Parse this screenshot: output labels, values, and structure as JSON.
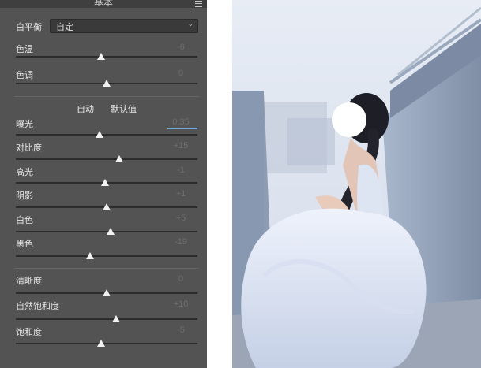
{
  "panel": {
    "title": "基本",
    "white_balance": {
      "label": "白平衡:",
      "value": "自定"
    },
    "auto_label": "自动",
    "default_label": "默认值",
    "sliders": [
      {
        "id": "temperature",
        "label": "色温",
        "value": "-6",
        "position": 0.47
      },
      {
        "id": "tint",
        "label": "色调",
        "value": "0",
        "position": 0.5
      },
      {
        "id": "exposure",
        "label": "曝光",
        "value": "0.35",
        "position": 0.46
      },
      {
        "id": "contrast",
        "label": "对比度",
        "value": "+15",
        "position": 0.57
      },
      {
        "id": "highlights",
        "label": "高光",
        "value": "-1",
        "position": 0.49
      },
      {
        "id": "shadows",
        "label": "阴影",
        "value": "+1",
        "position": 0.5
      },
      {
        "id": "whites",
        "label": "白色",
        "value": "+5",
        "position": 0.52
      },
      {
        "id": "blacks",
        "label": "黑色",
        "value": "-19",
        "position": 0.41
      },
      {
        "id": "clarity",
        "label": "清晰度",
        "value": "0",
        "position": 0.5
      },
      {
        "id": "vibrance",
        "label": "自然饱和度",
        "value": "+10",
        "position": 0.55
      },
      {
        "id": "saturation",
        "label": "饱和度",
        "value": "-5",
        "position": 0.47
      }
    ]
  },
  "photo": {
    "description_icon": "photo-image"
  }
}
